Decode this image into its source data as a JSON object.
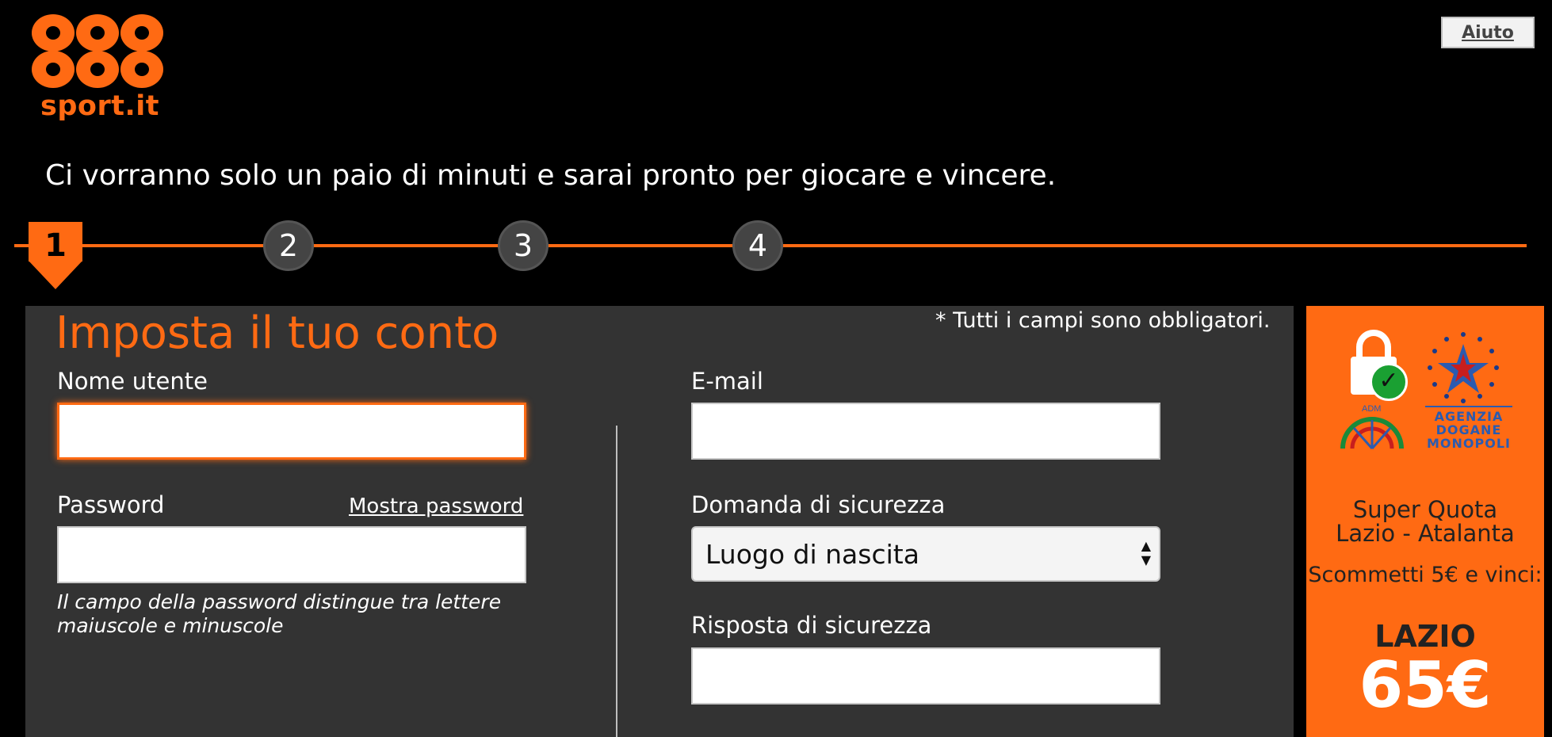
{
  "header": {
    "logo_digits": "888",
    "logo_tld": "sport.it",
    "help_label": "Aiuto",
    "tagline": "Ci vorranno solo un paio di minuti e sarai pronto per giocare e vincere."
  },
  "steps": [
    "1",
    "2",
    "3",
    "4"
  ],
  "active_step": 1,
  "form": {
    "title": "Imposta il tuo conto",
    "required_note": "* Tutti i campi sono obbligatori.",
    "username_label": "Nome utente",
    "username_value": "",
    "password_label": "Password",
    "password_value": "",
    "show_password": "Mostra password",
    "password_hint": "Il campo della password distingue tra lettere maiuscole e minuscole",
    "email_label": "E-mail",
    "email_value": "",
    "security_question_label": "Domanda di sicurezza",
    "security_question_value": "Luogo di nascita",
    "security_answer_label": "Risposta di sicurezza",
    "security_answer_value": ""
  },
  "promo": {
    "adm_small": "ADM",
    "agency_text": "AGENZIA DOGANE MONOPOLI",
    "line1": "Super Quota",
    "line2": "Lazio - Atalanta",
    "line3": "Scommetti 5€ e vinci:",
    "team": "LAZIO",
    "amount": "65€"
  },
  "colors": {
    "accent": "#ff6a13",
    "panel": "#333333",
    "background": "#000000"
  }
}
